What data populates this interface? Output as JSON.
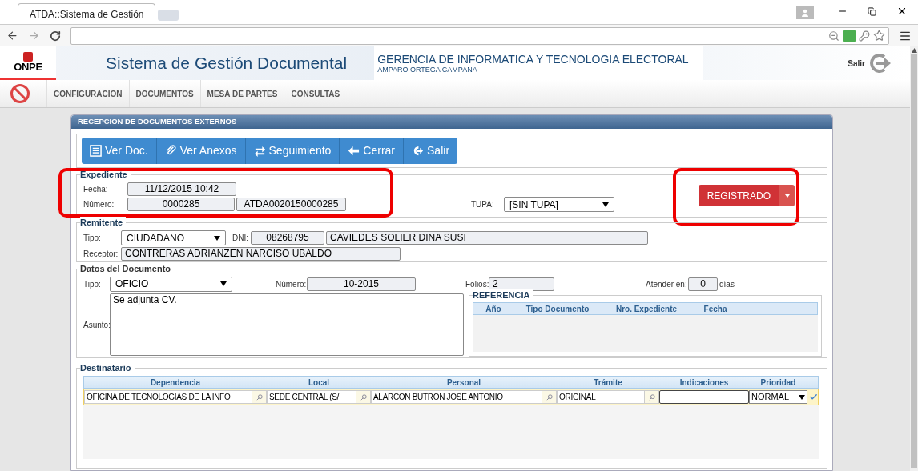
{
  "browser": {
    "tab_title": "ATDA::Sistema de Gestión"
  },
  "header": {
    "logo": "ONPE",
    "title": "Sistema de Gestión Documental",
    "org": "GERENCIA DE INFORMATICA Y TECNOLOGIA ELECTORAL",
    "user": "AMPARO ORTEGA CAMPANA",
    "exit": "Salir"
  },
  "menu": [
    "CONFIGURACION",
    "DOCUMENTOS",
    "MESA DE PARTES",
    "CONSULTAS"
  ],
  "panel": {
    "title": "RECEPCION DE DOCUMENTOS EXTERNOS"
  },
  "toolbar": [
    {
      "kind": "list",
      "label": "Ver Doc."
    },
    {
      "kind": "clip",
      "label": "Ver Anexos"
    },
    {
      "kind": "swap",
      "label": "Seguimiento"
    },
    {
      "kind": "back",
      "label": "Cerrar"
    },
    {
      "kind": "exit",
      "label": "Salir"
    }
  ],
  "expediente": {
    "legend": "Expediente",
    "fecha_label": "Fecha:",
    "fecha": "11/12/2015 10:42",
    "numero_label": "Número:",
    "numero": "0000285",
    "codigo": "ATDA0020150000285",
    "tupa_label": "TUPA:",
    "tupa": "[SIN TUPA]",
    "status": "REGISTRADO"
  },
  "remitente": {
    "legend": "Remitente",
    "tipo_label": "Tipo:",
    "tipo": "CIUDADANO",
    "dni_label": "DNI:",
    "dni": "08268795",
    "nombre": "CAVIEDES SOLIER DINA SUSI",
    "receptor_label": "Receptor:",
    "receptor": "CONTRERAS ADRIANZEN NARCISO UBALDO"
  },
  "documento": {
    "legend": "Datos del Documento",
    "tipo_label": "Tipo:",
    "tipo": "OFICIO",
    "numero_label": "Número:",
    "numero": "10-2015",
    "folios_label": "Folios:",
    "folios": "2",
    "atender_label": "Atender en:",
    "atender": "0",
    "dias": "días",
    "asunto_label": "Asunto:",
    "asunto": "Se adjunta CV."
  },
  "referencia": {
    "legend": "REFERENCIA",
    "columns": [
      "Año",
      "Tipo Documento",
      "Nro. Expediente",
      "Fecha"
    ]
  },
  "destinatario": {
    "legend": "Destinatario",
    "columns": [
      "Dependencia",
      "Local",
      "Personal",
      "Trámite",
      "Indicaciones",
      "Prioridad"
    ],
    "rows": [
      {
        "cells": [
          {
            "kind": "lookup",
            "value": "OFICINA DE TECNOLOGIAS DE LA INFO"
          },
          {
            "kind": "lookup",
            "value": "SEDE CENTRAL (S/"
          },
          {
            "kind": "lookup",
            "value": "ALARCON BUTRON JOSE ANTONIO"
          },
          {
            "kind": "lookup",
            "value": "ORIGINAL"
          },
          {
            "kind": "textarea"
          },
          {
            "kind": "select",
            "value": "NORMAL"
          }
        ]
      }
    ]
  }
}
